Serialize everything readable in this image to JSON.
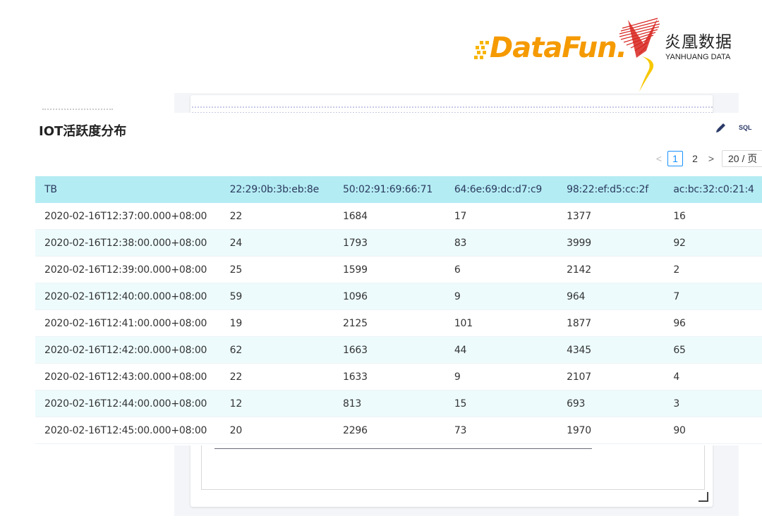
{
  "logos": {
    "datafun": "DataFun.",
    "yanhuang_cn": "炎凰数据",
    "yanhuang_en": "YANHUANG DATA",
    "colors": {
      "datafun": "#f59a00",
      "yanhuang_red": "#d8241f",
      "yanhuang_yellow": "#f7c800"
    }
  },
  "panel": {
    "title": "IOT活跃度分布",
    "edit_icon": "pencil-icon",
    "sql_label": "SQL"
  },
  "pagination": {
    "prev": "<",
    "pages": [
      "1",
      "2"
    ],
    "current": "1",
    "next": ">",
    "page_size": "20 / 页"
  },
  "table": {
    "columns": [
      "TB",
      "22:29:0b:3b:eb:8e",
      "50:02:91:69:66:71",
      "64:6e:69:dc:d7:c9",
      "98:22:ef:d5:cc:2f",
      "ac:bc:32:c0:21:4"
    ],
    "rows": [
      [
        "2020-02-16T12:37:00.000+08:00",
        "22",
        "1684",
        "17",
        "1377",
        "16"
      ],
      [
        "2020-02-16T12:38:00.000+08:00",
        "24",
        "1793",
        "83",
        "3999",
        "92"
      ],
      [
        "2020-02-16T12:39:00.000+08:00",
        "25",
        "1599",
        "6",
        "2142",
        "2"
      ],
      [
        "2020-02-16T12:40:00.000+08:00",
        "59",
        "1096",
        "9",
        "964",
        "7"
      ],
      [
        "2020-02-16T12:41:00.000+08:00",
        "19",
        "2125",
        "101",
        "1877",
        "96"
      ],
      [
        "2020-02-16T12:42:00.000+08:00",
        "62",
        "1663",
        "44",
        "4345",
        "65"
      ],
      [
        "2020-02-16T12:43:00.000+08:00",
        "22",
        "1633",
        "9",
        "2107",
        "4"
      ],
      [
        "2020-02-16T12:44:00.000+08:00",
        "12",
        "813",
        "15",
        "693",
        "3"
      ],
      [
        "2020-02-16T12:45:00.000+08:00",
        "20",
        "2296",
        "73",
        "1970",
        "90"
      ]
    ],
    "colors": {
      "header_bg": "#b4ecf3",
      "stripe_bg": "#edfbfd",
      "accent": "#1890ff"
    }
  }
}
